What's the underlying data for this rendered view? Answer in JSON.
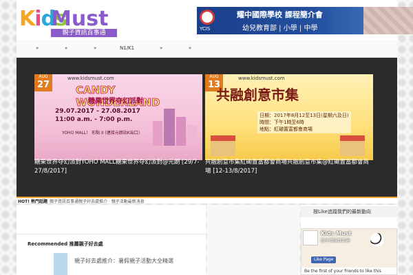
{
  "header": {
    "logo": {
      "kids": "Kids",
      "must": "Must",
      "tagline": "親子資訊百事通"
    },
    "ad": {
      "school_en": "YCIS",
      "title": "耀中國際學校 課程簡介會",
      "subtitle": "幼兒教育部 | 小學 | 中學"
    }
  },
  "nav": {
    "items": [
      {
        "label": "»"
      },
      {
        "label": "»"
      },
      {
        "label": "»"
      },
      {
        "label": "N1/K1"
      },
      {
        "label": "»"
      },
      {
        "label": "»"
      }
    ]
  },
  "slider": {
    "slides": [
      {
        "month": "AUG",
        "day": "27",
        "url": "www.kidsmust.com",
        "title_en": "CANDY WONDERLAND",
        "title_zh": "糖果世界夺幻派對",
        "dates": "29.07.2017 - 27.08.2017",
        "time": "11:00 a.m. - 7:00 p.m.",
        "venue": "YOHO MALL！ 形點 II (連接元朗站K出口)",
        "caption": "糖果世界夺幻派對YOHO MALL糖果世界夺幻派對@元朗 [29/7-27/8/2017]"
      },
      {
        "month": "AUG",
        "day": "13",
        "url": "www.kidsmust.com",
        "title_zh": "共融創意市集",
        "date_line": "日期：2017年8月12至13日(星期六及日)",
        "time_line": "時間：下午1時至6時",
        "venue_line": "地點：紅磡置富都會商場",
        "caption": "共融創意市集紅磡置富都會商場共融創意市集@紅磡置富都會商場 [12-13/8/2017]"
      }
    ]
  },
  "ticker": {
    "label": "HOT! 熱門話題",
    "text": "親子資訊百事通親子好去處推介 · 親子活動最新消息"
  },
  "main": {
    "recommended_title": "Recommended 推薦親子好去處",
    "recommended_item": "親子好去處推介：暑假親子活動大全精選"
  },
  "sidebar": {
    "heading": "按Like追蹤我們的最新動向",
    "fb": {
      "page_name": "Kids Must",
      "likes": "親子資訊百事通",
      "like_button": "Like Page",
      "footer": "Be the first of your friends to like this"
    }
  }
}
